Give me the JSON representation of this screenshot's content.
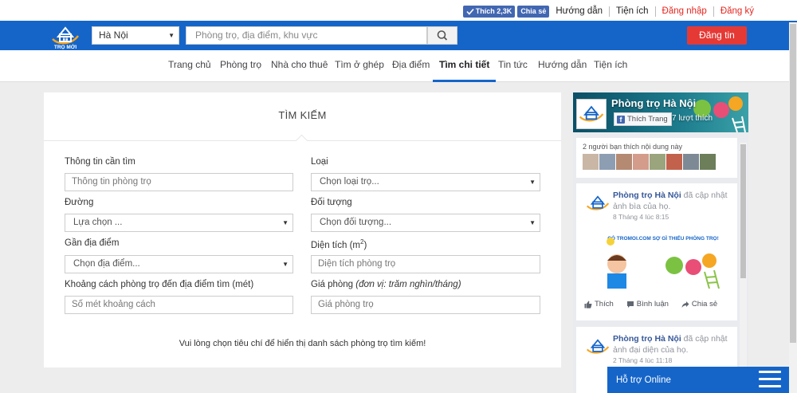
{
  "topbar": {
    "fb_like_label": "Thích 2,3K",
    "fb_share_label": "Chia sẻ",
    "links": [
      "Hướng dẫn",
      "Tiện ích",
      "Đăng nhập",
      "Đăng ký"
    ]
  },
  "header": {
    "logo_text": "TRỌ MỚI",
    "city": "Hà Nội",
    "search_placeholder": "Phòng trọ, địa điểm, khu vực",
    "post_button": "Đăng tin",
    "brand_color": "#1565c9",
    "accent_color": "#e53935"
  },
  "nav": {
    "items": [
      "Trang chủ",
      "Phòng trọ",
      "Nhà cho thuê",
      "Tìm ở ghép",
      "Địa điểm",
      "Tìm chi tiết",
      "Tin tức",
      "Hướng dẫn",
      "Tiện ích"
    ],
    "active": "Tìm chi tiết"
  },
  "search": {
    "title": "TÌM KIẾM",
    "info_label": "Thông tin cần tìm",
    "info_placeholder": "Thông tin phòng trọ",
    "type_label": "Loại",
    "type_value": "Chọn loại trọ...",
    "street_label": "Đường",
    "street_value": "Lựa chọn ...",
    "target_label": "Đối tượng",
    "target_value": "Chọn đối tượng...",
    "near_label": "Gần địa điểm",
    "near_value": "Chọn địa điểm...",
    "area_label_main": "Diện tích (m",
    "area_label_sup": "2",
    "area_label_end": ")",
    "area_placeholder": "Diện tích phòng trọ",
    "distance_label": "Khoảng cách phòng trọ đến địa điểm tìm (mét)",
    "distance_placeholder": "Số mét khoảng cách",
    "price_label_main": "Giá phòng",
    "price_label_note": "(đơn vị: trăm nghìn/tháng)",
    "price_placeholder": "Giá phòng trọ",
    "message": "Vui lòng chọn tiêu chí để hiển thị danh sách phòng trọ tìm kiếm!"
  },
  "facebook": {
    "page_name": "Phòng trọ Hà Nội",
    "like_button": "Thích Trang",
    "like_count": "7 lượt thích",
    "friends_text": "2 người bạn thích nội dung này",
    "posts": [
      {
        "author": "Phòng trọ Hà Nội",
        "action": "đã cập nhật ảnh bìa của họ.",
        "time": "8 Tháng 4 lúc 8:15",
        "image_caption": "CÓ TROMOI.COM SỢ GÌ THIẾU PHÒNG TRỌ!",
        "actions": [
          "Thích",
          "Bình luận",
          "Chia sẻ"
        ]
      },
      {
        "author": "Phòng trọ Hà Nội",
        "action": "đã cập nhật ảnh đại diện của họ.",
        "time": "2 Tháng 4 lúc 11:18"
      }
    ]
  },
  "support": {
    "label": "Hỗ trợ Online"
  }
}
